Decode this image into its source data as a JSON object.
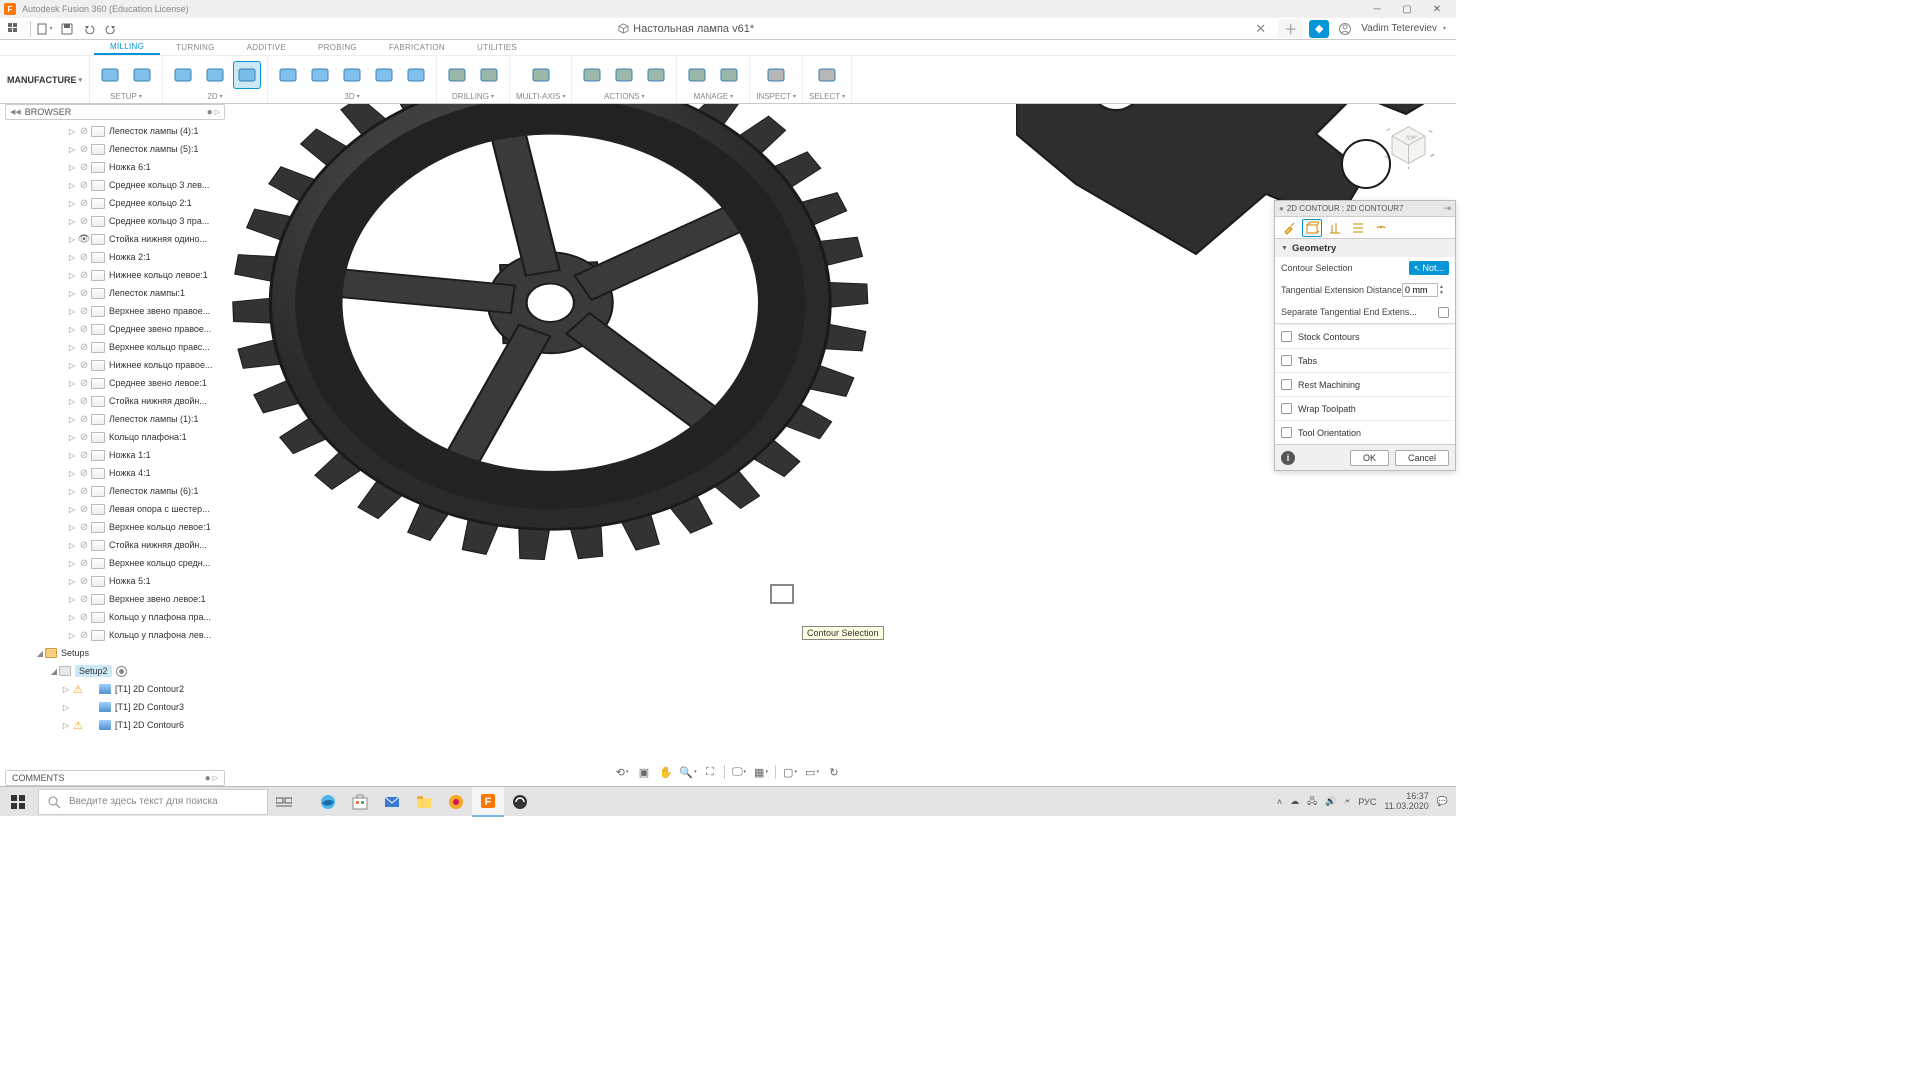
{
  "app": {
    "title": "Autodesk Fusion 360 (Education License)"
  },
  "doc": {
    "title": "Настольная лампа v61*"
  },
  "user": {
    "name": "Vadim Tetereviev"
  },
  "tabs": [
    "MILLING",
    "TURNING",
    "ADDITIVE",
    "PROBING",
    "FABRICATION",
    "UTILITIES"
  ],
  "activeTab": 0,
  "workspace": "MANUFACTURE",
  "ribbon": [
    {
      "label": "SETUP",
      "icons": 2
    },
    {
      "label": "2D",
      "icons": 3
    },
    {
      "label": "3D",
      "icons": 5
    },
    {
      "label": "DRILLING",
      "icons": 2
    },
    {
      "label": "MULTI-AXIS",
      "icons": 1
    },
    {
      "label": "ACTIONS",
      "icons": 3
    },
    {
      "label": "MANAGE",
      "icons": 2
    },
    {
      "label": "INSPECT",
      "icons": 1
    },
    {
      "label": "SELECT",
      "icons": 1
    }
  ],
  "browser": {
    "title": "BROWSER",
    "items": [
      "Лепесток лампы (4):1",
      "Лепесток лампы (5):1",
      "Ножка 6:1",
      "Среднее кольцо 3 лев...",
      "Среднее кольцо 2:1",
      "Среднее кольцо 3 пра...",
      "Стойка нижняя одино...",
      "Ножка 2:1",
      "Нижнее кольцо левое:1",
      "Лепесток лампы:1",
      "Верхнее звено правое...",
      "Среднее звено правое...",
      "Верхнее кольцо правс...",
      "Нижнее кольцо правое...",
      "Среднее звено левое:1",
      "Стойка нижняя двойн...",
      "Лепесток лампы (1):1",
      "Кольцо плафона:1",
      "Ножка 1:1",
      "Ножка 4:1",
      "Лепесток лампы (6):1",
      "Левая опора с шестер...",
      "Верхнее кольцо левое:1",
      "Стойка нижняя двойн...",
      "Верхнее кольцо средн...",
      "Ножка 5:1",
      "Верхнее звено левое:1",
      "Кольцо у плафона пра...",
      "Кольцо у плафона лев..."
    ],
    "eyeOn": [
      6
    ],
    "setups": "Setups",
    "setup2": "Setup2",
    "ops": [
      {
        "label": "[T1] 2D Contour2",
        "warn": true
      },
      {
        "label": "[T1] 2D Contour3",
        "warn": false
      },
      {
        "label": "[T1] 2D Contour6",
        "warn": true
      }
    ]
  },
  "comments": "COMMENTS",
  "tooltip": "Contour Selection",
  "viewcube": {
    "face": "TOP"
  },
  "prop": {
    "title": "2D CONTOUR : 2D CONTOUR7",
    "geometry": "Geometry",
    "rows": {
      "contourSel": "Contour Selection",
      "contourBtn": "Not...",
      "tanExt": "Tangential Extension Distance",
      "tanVal": "0 mm",
      "sepTan": "Separate Tangential End Extens..."
    },
    "checks": [
      "Stock Contours",
      "Tabs",
      "Rest Machining",
      "Wrap Toolpath",
      "Tool Orientation"
    ],
    "ok": "OK",
    "cancel": "Cancel"
  },
  "search": {
    "placeholder": "Введите здесь текст для поиска"
  },
  "clock": {
    "time": "16:37",
    "date": "11.03.2020"
  },
  "lang": "РУС"
}
